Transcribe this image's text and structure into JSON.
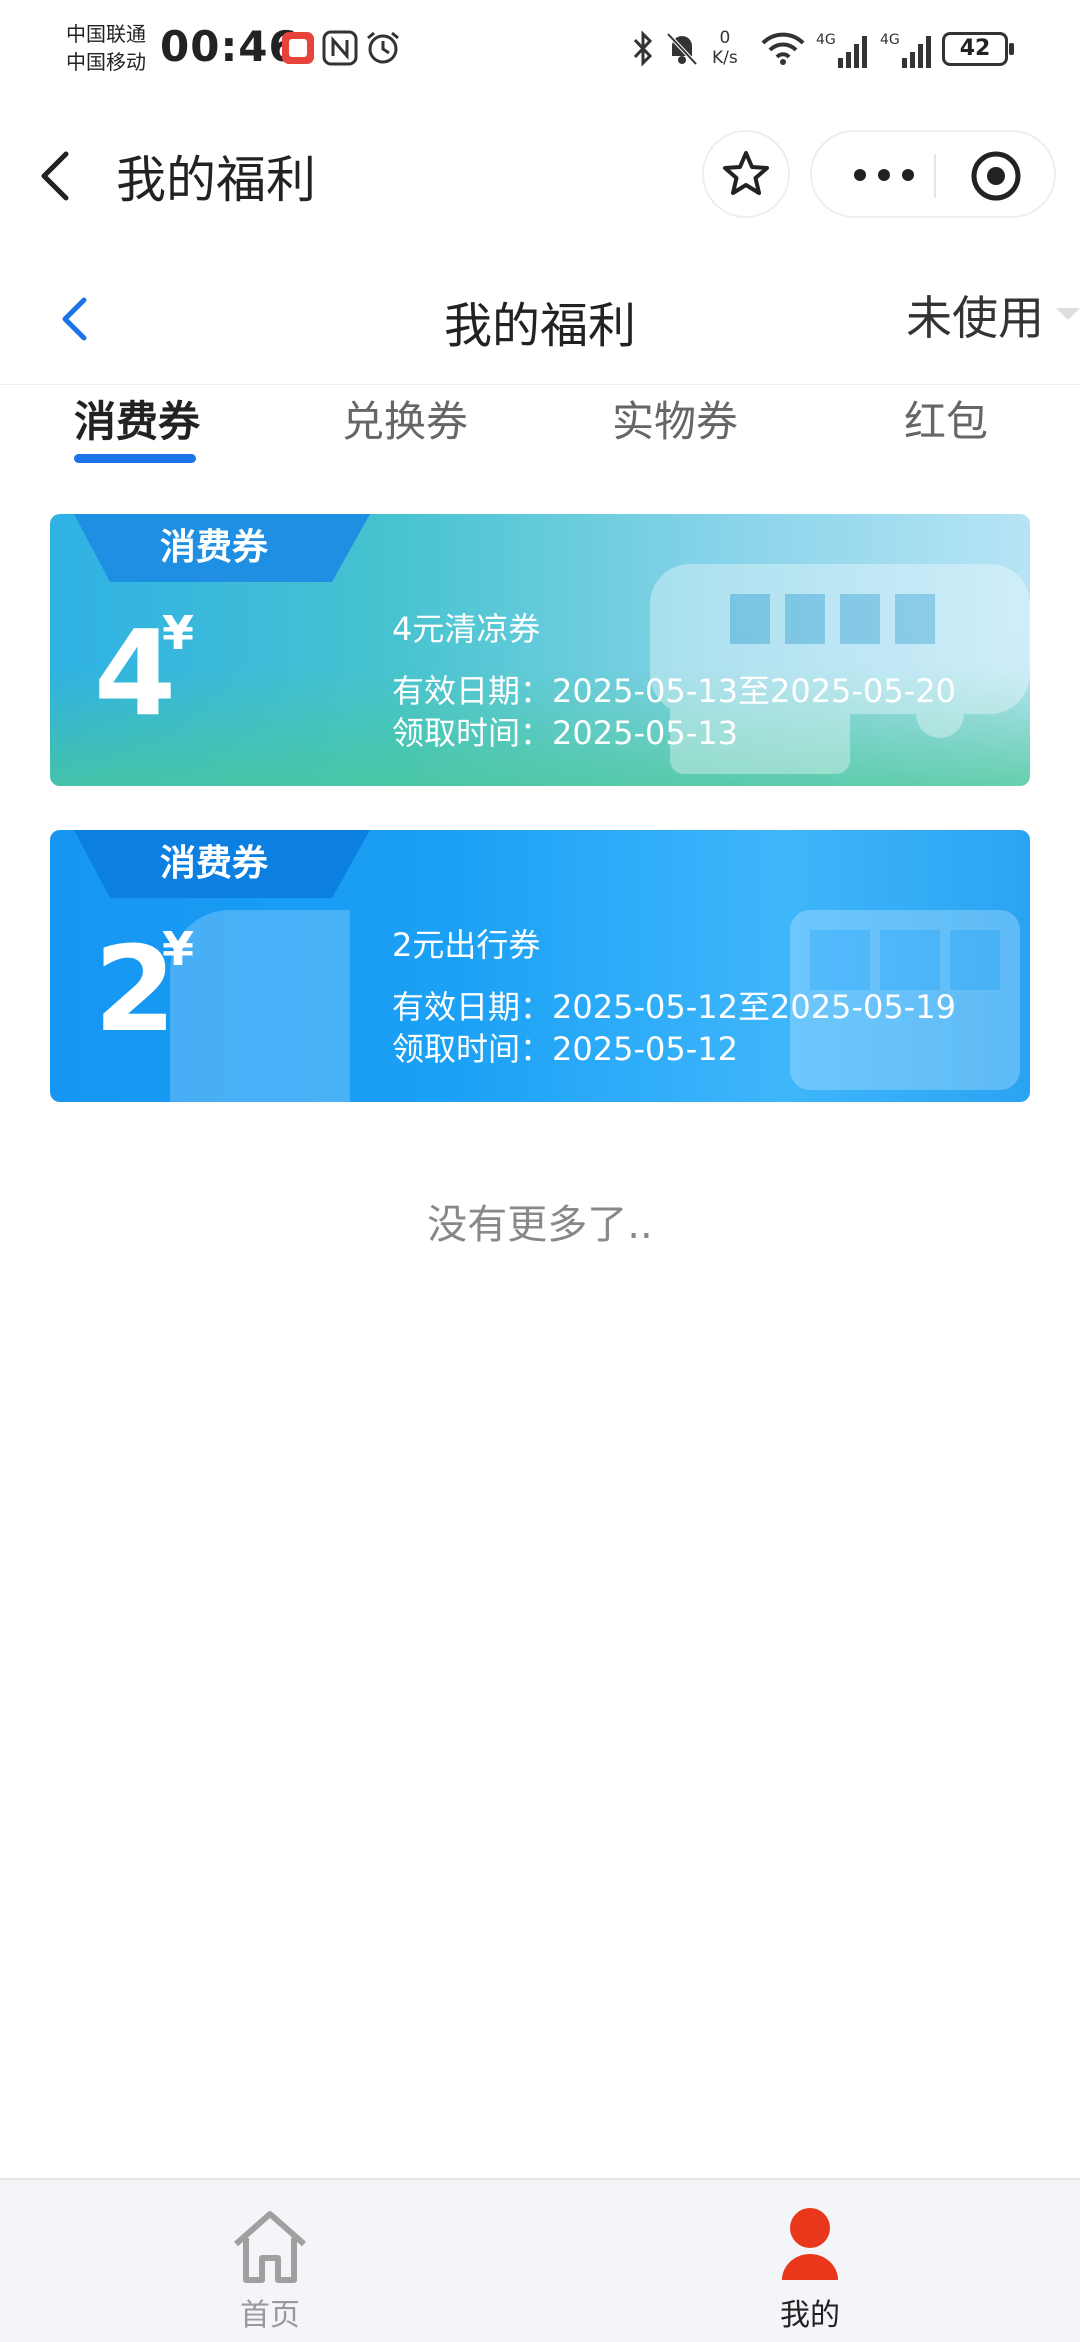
{
  "status_bar": {
    "carrier_1": "中国联通",
    "carrier_2": "中国移动",
    "time": "00:46",
    "net_speed_value": "0",
    "net_speed_unit": "K/s",
    "battery": "42"
  },
  "mini_header": {
    "title": "我的福利"
  },
  "page_nav": {
    "title": "我的福利",
    "filter_label": "未使用"
  },
  "tabs": [
    {
      "label": "消费券",
      "active": true
    },
    {
      "label": "兑换券",
      "active": false
    },
    {
      "label": "实物券",
      "active": false
    },
    {
      "label": "红包",
      "active": false
    }
  ],
  "coupons": [
    {
      "badge": "消费券",
      "amount": "4",
      "currency": "¥",
      "name": "4元清凉券",
      "valid_text": "有效日期：2025-05-13至2025-05-20",
      "claim_text": "领取时间：2025-05-13"
    },
    {
      "badge": "消费券",
      "amount": "2",
      "currency": "¥",
      "name": "2元出行券",
      "valid_text": "有效日期：2025-05-12至2025-05-19",
      "claim_text": "领取时间：2025-05-12"
    }
  ],
  "end_text": "没有更多了..",
  "bottom_nav": [
    {
      "label": "首页",
      "icon": "home-icon",
      "active": false
    },
    {
      "label": "我的",
      "icon": "user-icon",
      "active": true
    }
  ],
  "colors": {
    "accent": "#1a73e8",
    "user_icon": "#e8371b",
    "coupon1_start": "#2fb1e5",
    "coupon2_start": "#1696f2"
  }
}
